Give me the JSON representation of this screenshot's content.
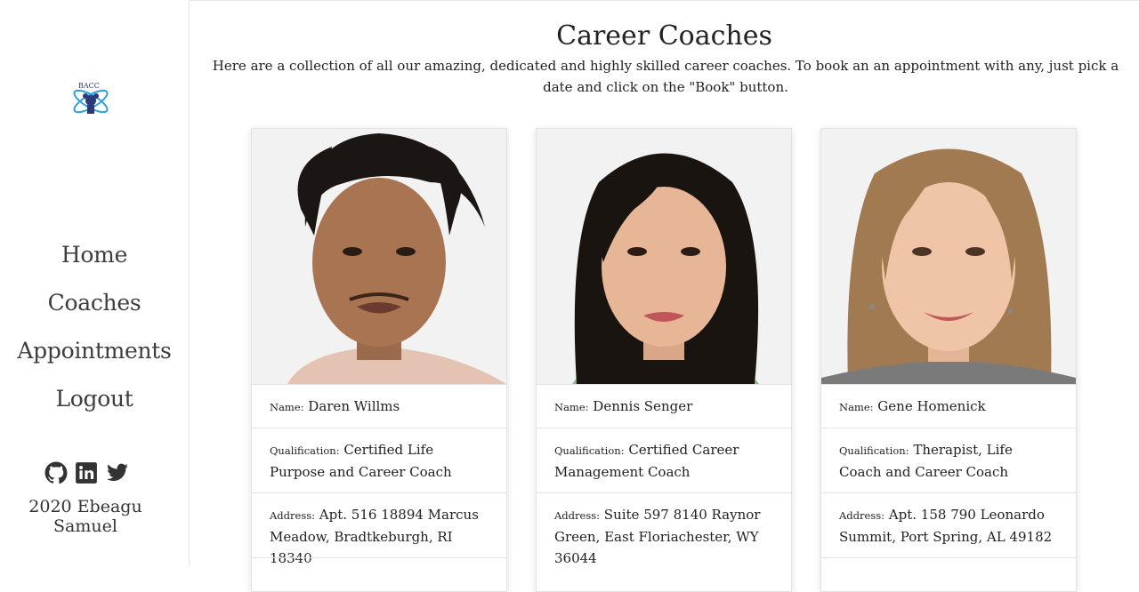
{
  "sidebar": {
    "logo_text": "BACC",
    "nav": [
      {
        "label": "Home"
      },
      {
        "label": "Coaches"
      },
      {
        "label": "Appointments"
      },
      {
        "label": "Logout"
      }
    ],
    "socials": [
      "github-icon",
      "linkedin-icon",
      "twitter-icon"
    ],
    "footer": "2020 Ebeagu Samuel"
  },
  "main": {
    "title": "Career Coaches",
    "intro": "Here are a collection of all our amazing, dedicated and highly skilled career coaches. To book an an appointment with any, just pick a date and click on the \"Book\" button."
  },
  "labels": {
    "name": "Name:",
    "qualification": "Qualification:",
    "address": "Address:"
  },
  "coaches": [
    {
      "name": "Daren Willms",
      "qualification": "Certified Life Purpose and Career Coach",
      "address": "Apt. 516 18894 Marcus Meadow, Bradtkeburgh, RI 18340"
    },
    {
      "name": "Dennis Senger",
      "qualification": "Certified Career Management Coach",
      "address": "Suite 597 8140 Raynor Green, East Floriachester, WY 36044"
    },
    {
      "name": "Gene Homenick",
      "qualification": "Therapist, Life Coach and Career Coach",
      "address": "Apt. 158 790 Leonardo Summit, Port Spring, AL 49182"
    }
  ],
  "colors": {
    "accent": "#2e9fd8",
    "text": "#333333"
  }
}
